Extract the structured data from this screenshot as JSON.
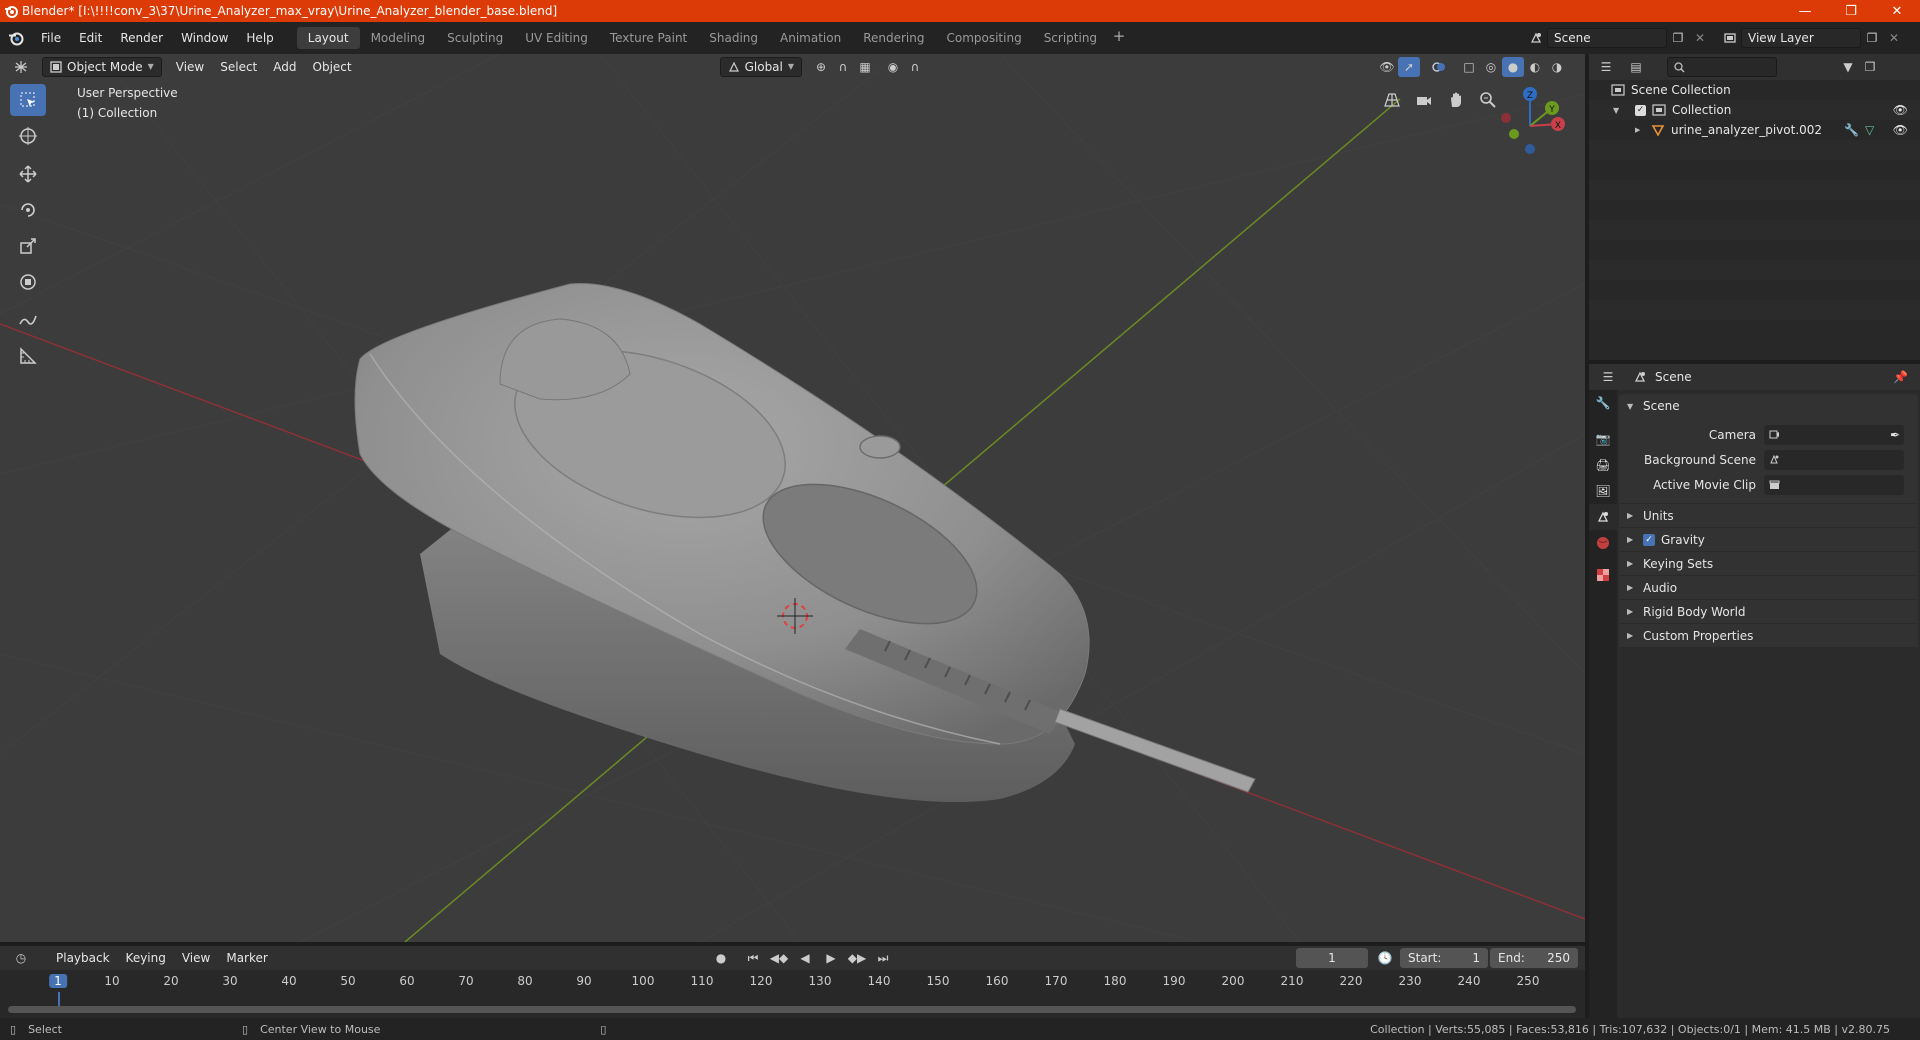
{
  "window": {
    "title": "Blender* [I:\\!!!!conv_3\\37\\Urine_Analyzer_max_vray\\Urine_Analyzer_blender_base.blend]",
    "accent": "#dc3a06"
  },
  "menu": [
    "File",
    "Edit",
    "Render",
    "Window",
    "Help"
  ],
  "workspaces": [
    "Layout",
    "Modeling",
    "Sculpting",
    "UV Editing",
    "Texture Paint",
    "Shading",
    "Animation",
    "Rendering",
    "Compositing",
    "Scripting"
  ],
  "active_workspace": "Layout",
  "scene_selector": {
    "scene": "Scene",
    "view_layer": "View Layer"
  },
  "viewport": {
    "mode": "Object Mode",
    "menus": [
      "View",
      "Select",
      "Add",
      "Object"
    ],
    "transform_orientation": "Global",
    "overlay_line1": "User Perspective",
    "overlay_line2": "(1) Collection",
    "axis_labels": {
      "x": "X",
      "y": "Y",
      "z": "Z"
    },
    "selection_color": "#4772b3"
  },
  "outliner": {
    "root": "Scene Collection",
    "collection": "Collection",
    "object": "urine_analyzer_pivot.002"
  },
  "properties": {
    "context": "Scene",
    "panel_title": "Scene",
    "fields": [
      {
        "label": "Camera"
      },
      {
        "label": "Background Scene"
      },
      {
        "label": "Active Movie Clip"
      }
    ],
    "subpanels": [
      "Units",
      "Gravity",
      "Keying Sets",
      "Audio",
      "Rigid Body World",
      "Custom Properties"
    ]
  },
  "timeline": {
    "menus": [
      "Playback",
      "Keying",
      "View",
      "Marker"
    ],
    "current_frame": "1",
    "start_label": "Start:",
    "start": "1",
    "end_label": "End:",
    "end": "250",
    "ticks": [
      "1",
      "10",
      "20",
      "30",
      "40",
      "50",
      "60",
      "70",
      "80",
      "90",
      "100",
      "110",
      "120",
      "130",
      "140",
      "150",
      "160",
      "170",
      "180",
      "190",
      "200",
      "210",
      "220",
      "230",
      "240",
      "250"
    ]
  },
  "statusbar": {
    "left_action": "Select",
    "mid_action": "Center View to Mouse",
    "stats": "Collection | Verts:55,085 | Faces:53,816 | Tris:107,632 | Objects:0/1 | Mem: 41.5 MB | v2.80.75"
  }
}
